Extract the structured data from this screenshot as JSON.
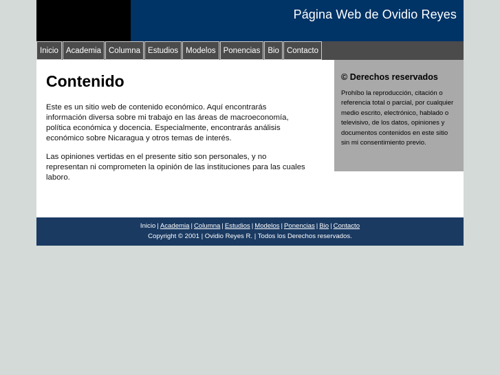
{
  "header": {
    "title": "Página Web de Ovidio Reyes"
  },
  "nav": [
    {
      "label": "Inicio"
    },
    {
      "label": "Academia"
    },
    {
      "label": "Columna"
    },
    {
      "label": "Estudios"
    },
    {
      "label": "Modelos"
    },
    {
      "label": "Ponencias"
    },
    {
      "label": "Bio"
    },
    {
      "label": "Contacto"
    }
  ],
  "main": {
    "heading": "Contenido",
    "paragraphs": [
      "Este es un sitio web de contenido económico. Aquí encontrarás información diversa sobre mi trabajo en las áreas de macroeconomía, política económica y docencia. Especialmente, encontrarás análisis económico sobre Nicaragua y otros temas de interés.",
      "Las opiniones vertidas en el presente sitio son personales, y no representan ni comprometen la opinión de las instituciones para las cuales laboro."
    ]
  },
  "sidebar": {
    "heading": "© Derechos reservados",
    "text": "Prohíbo la reproducción, citación o referencia total o parcial, por cualquier medio escrito, electrónico, hablado o televisivo, de los datos, opiniones y documentos contenidos en este sitio sin mi consentimiento previo."
  },
  "footer": {
    "links": [
      {
        "label": "Inicio",
        "link": false
      },
      {
        "label": "Academia",
        "link": true
      },
      {
        "label": "Columna",
        "link": true
      },
      {
        "label": "Estudios",
        "link": true
      },
      {
        "label": "Modelos",
        "link": true
      },
      {
        "label": "Ponencias",
        "link": true
      },
      {
        "label": "Bio",
        "link": true
      },
      {
        "label": "Contacto",
        "link": true
      }
    ],
    "separator": "|",
    "copyright": "Copyright © 2001 | Ovidio Reyes R. | Todos los Derechos reservados."
  },
  "colors": {
    "header_bg": "#003366",
    "nav_bg": "#4b4b4b",
    "sidebar_bg": "#a9a9a9",
    "footer_bg": "#1a3a62",
    "page_bg": "#d4dad8"
  }
}
